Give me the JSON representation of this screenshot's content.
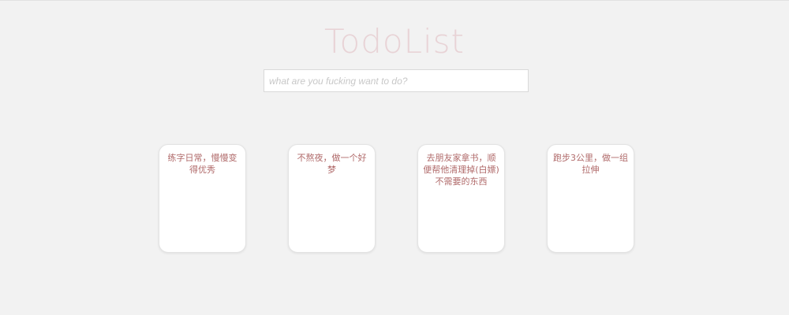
{
  "app": {
    "title": "TodoList"
  },
  "input": {
    "placeholder": "what are you fucking want to do?",
    "value": ""
  },
  "todos": [
    {
      "text": "练字日常，慢慢变得优秀"
    },
    {
      "text": "不熬夜，做一个好梦"
    },
    {
      "text": "去朋友家拿书，顺便帮他清理掉(白嫖)不需要的东西"
    },
    {
      "text": "跑步3公里，做一组拉伸"
    }
  ],
  "colors": {
    "background": "#f2f2f2",
    "title": "#e8d3d6",
    "card_text": "#b06a6a",
    "card_background": "#ffffff"
  }
}
